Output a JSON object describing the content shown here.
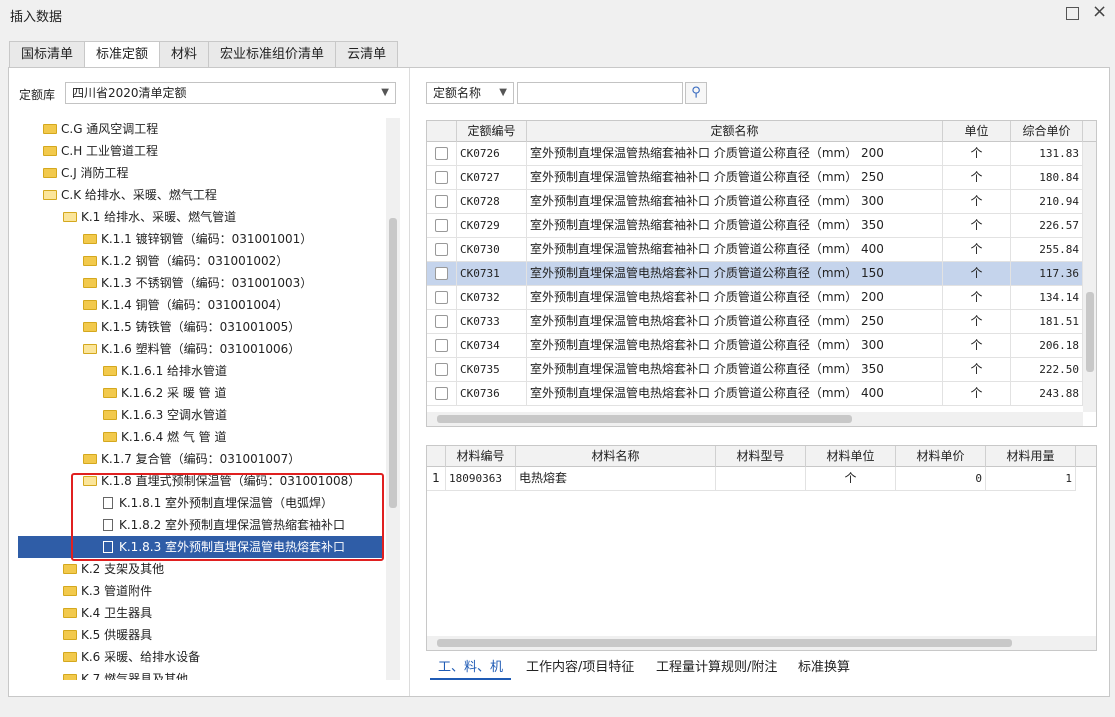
{
  "window": {
    "title": "插入数据",
    "maximize_icon": "maximize-icon",
    "close_label": "×"
  },
  "tabs": [
    "国标清单",
    "标准定额",
    "材料",
    "宏业标准组价清单",
    "云清单"
  ],
  "active_tab": 1,
  "left": {
    "library_label": "定额库",
    "library_value": "四川省2020清单定额",
    "tree": [
      {
        "label": "C.G 通风空调工程",
        "level": 1,
        "icon": "folder"
      },
      {
        "label": "C.H 工业管道工程",
        "level": 1,
        "icon": "folder"
      },
      {
        "label": "C.J 消防工程",
        "level": 1,
        "icon": "folder"
      },
      {
        "label": "C.K 给排水、采暖、燃气工程",
        "level": 1,
        "icon": "folder-open"
      },
      {
        "label": "K.1 给排水、采暖、燃气管道",
        "level": 2,
        "icon": "folder-open"
      },
      {
        "label": "K.1.1 镀锌钢管（编码：031001001）",
        "level": 3,
        "icon": "folder"
      },
      {
        "label": "K.1.2 钢管（编码：031001002）",
        "level": 3,
        "icon": "folder"
      },
      {
        "label": "K.1.3 不锈钢管（编码：031001003）",
        "level": 3,
        "icon": "folder"
      },
      {
        "label": "K.1.4 铜管（编码：031001004）",
        "level": 3,
        "icon": "folder"
      },
      {
        "label": "K.1.5 铸铁管（编码：031001005）",
        "level": 3,
        "icon": "folder"
      },
      {
        "label": "K.1.6 塑料管（编码：031001006）",
        "level": 3,
        "icon": "folder-open"
      },
      {
        "label": "K.1.6.1 给排水管道",
        "level": 4,
        "icon": "folder"
      },
      {
        "label": "K.1.6.2 采 暖 管 道",
        "level": 4,
        "icon": "folder"
      },
      {
        "label": "K.1.6.3 空调水管道",
        "level": 4,
        "icon": "folder"
      },
      {
        "label": "K.1.6.4 燃 气 管 道",
        "level": 4,
        "icon": "folder"
      },
      {
        "label": "K.1.7 复合管（编码：031001007）",
        "level": 3,
        "icon": "folder"
      },
      {
        "label": "K.1.8 直埋式预制保温管（编码：031001008）",
        "level": 3,
        "icon": "folder-open"
      },
      {
        "label": "K.1.8.1 室外预制直埋保温管（电弧焊）",
        "level": 4,
        "icon": "document"
      },
      {
        "label": "K.1.8.2 室外预制直埋保温管热缩套袖补口",
        "level": 4,
        "icon": "document"
      },
      {
        "label": "K.1.8.3 室外预制直埋保温管电热熔套补口",
        "level": 4,
        "icon": "document",
        "selected": true
      },
      {
        "label": "K.2 支架及其他",
        "level": 2,
        "icon": "folder"
      },
      {
        "label": "K.3 管道附件",
        "level": 2,
        "icon": "folder"
      },
      {
        "label": "K.4 卫生器具",
        "level": 2,
        "icon": "folder"
      },
      {
        "label": "K.5 供暖器具",
        "level": 2,
        "icon": "folder"
      },
      {
        "label": "K.6 采暖、给排水设备",
        "level": 2,
        "icon": "folder"
      },
      {
        "label": "K.7 燃气器具及其他",
        "level": 2,
        "icon": "folder"
      }
    ]
  },
  "right": {
    "search_field": "定额名称",
    "search_value": "",
    "search_icon": "search-icon",
    "quota_table": {
      "columns": [
        "",
        "定额编号",
        "定额名称",
        "单位",
        "综合单价"
      ],
      "rows": [
        {
          "code": "CK0726",
          "name": "室外预制直埋保温管热缩套袖补口 介质管道公称直径（mm） 200",
          "unit": "个",
          "price": "131.83"
        },
        {
          "code": "CK0727",
          "name": "室外预制直埋保温管热缩套袖补口 介质管道公称直径（mm） 250",
          "unit": "个",
          "price": "180.84"
        },
        {
          "code": "CK0728",
          "name": "室外预制直埋保温管热缩套袖补口 介质管道公称直径（mm） 300",
          "unit": "个",
          "price": "210.94"
        },
        {
          "code": "CK0729",
          "name": "室外预制直埋保温管热缩套袖补口 介质管道公称直径（mm） 350",
          "unit": "个",
          "price": "226.57"
        },
        {
          "code": "CK0730",
          "name": "室外预制直埋保温管热缩套袖补口 介质管道公称直径（mm） 400",
          "unit": "个",
          "price": "255.84"
        },
        {
          "code": "CK0731",
          "name": "室外预制直埋保温管电热熔套补口 介质管道公称直径（mm） 150",
          "unit": "个",
          "price": "117.36",
          "selected": true
        },
        {
          "code": "CK0732",
          "name": "室外预制直埋保温管电热熔套补口 介质管道公称直径（mm） 200",
          "unit": "个",
          "price": "134.14"
        },
        {
          "code": "CK0733",
          "name": "室外预制直埋保温管电热熔套补口 介质管道公称直径（mm） 250",
          "unit": "个",
          "price": "181.51"
        },
        {
          "code": "CK0734",
          "name": "室外预制直埋保温管电热熔套补口 介质管道公称直径（mm） 300",
          "unit": "个",
          "price": "206.18"
        },
        {
          "code": "CK0735",
          "name": "室外预制直埋保温管电热熔套补口 介质管道公称直径（mm） 350",
          "unit": "个",
          "price": "222.50"
        },
        {
          "code": "CK0736",
          "name": "室外预制直埋保温管电热熔套补口 介质管道公称直径（mm） 400",
          "unit": "个",
          "price": "243.88"
        }
      ]
    },
    "material_table": {
      "columns": [
        "",
        "材料编号",
        "材料名称",
        "材料型号",
        "材料单位",
        "材料单价",
        "材料用量"
      ],
      "rows": [
        {
          "index": "1",
          "code": "18090363",
          "name": "电热熔套",
          "model": "",
          "unit": "个",
          "price": "0",
          "qty": "1"
        }
      ]
    },
    "bottom_tabs": [
      "工、料、机",
      "工作内容/项目特征",
      "工程量计算规则/附注",
      "标准换算"
    ],
    "active_bottom_tab": 0
  }
}
